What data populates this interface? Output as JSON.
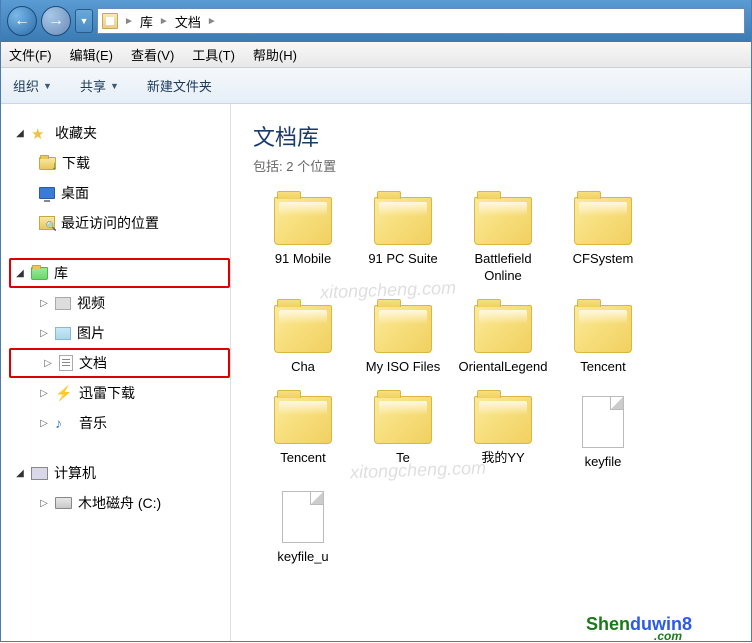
{
  "nav": {
    "back": "←",
    "forward": "→",
    "dropdown": "▼"
  },
  "breadcrumb": {
    "root_icon": "doc",
    "sep": "►",
    "p0": "库",
    "p1": "文档"
  },
  "menu": {
    "file": "文件(F)",
    "edit": "编辑(E)",
    "view": "查看(V)",
    "tools": "工具(T)",
    "help": "帮助(H)"
  },
  "toolbar": {
    "organize": "组织",
    "share": "共享",
    "newfolder": "新建文件夹",
    "dd": "▼"
  },
  "sidebar": {
    "fav": {
      "label": "收藏夹",
      "items": [
        {
          "name": "downloads",
          "label": "下载"
        },
        {
          "name": "desktop",
          "label": "桌面"
        },
        {
          "name": "recent",
          "label": "最近访问的位置"
        }
      ]
    },
    "lib": {
      "label": "库",
      "items": [
        {
          "name": "videos",
          "label": "视频"
        },
        {
          "name": "pictures",
          "label": "图片"
        },
        {
          "name": "documents",
          "label": "文档"
        },
        {
          "name": "thunder",
          "label": "迅雷下载"
        },
        {
          "name": "music",
          "label": "音乐"
        }
      ]
    },
    "computer": {
      "label": "计算机",
      "items": [
        {
          "name": "drive-c",
          "label": "木地磁舟 (C:)"
        }
      ]
    }
  },
  "content": {
    "title": "文档库",
    "subtitle": "包括: 2 个位置",
    "folders": [
      {
        "type": "folder",
        "label": "91 Mobile"
      },
      {
        "type": "folder",
        "label": "91 PC Suite"
      },
      {
        "type": "folder",
        "label": "Battlefield Online"
      },
      {
        "type": "folder",
        "label": "CFSystem"
      },
      {
        "type": "folder",
        "label": "Cha"
      },
      {
        "type": "folder",
        "label": "My ISO Files"
      },
      {
        "type": "folder",
        "label": "OrientalLegend"
      },
      {
        "type": "folder",
        "label": "Tencent"
      },
      {
        "type": "folder",
        "label": "Tencent"
      },
      {
        "type": "folder",
        "label": "Te"
      },
      {
        "type": "folder",
        "label": "我的YY"
      },
      {
        "type": "file",
        "label": "keyfile"
      },
      {
        "type": "file",
        "label": "keyfile_u"
      }
    ]
  },
  "watermark": "xitongcheng.com",
  "brand": {
    "part1": "Shen",
    "part2": "duwin8",
    "sub": ".com"
  }
}
